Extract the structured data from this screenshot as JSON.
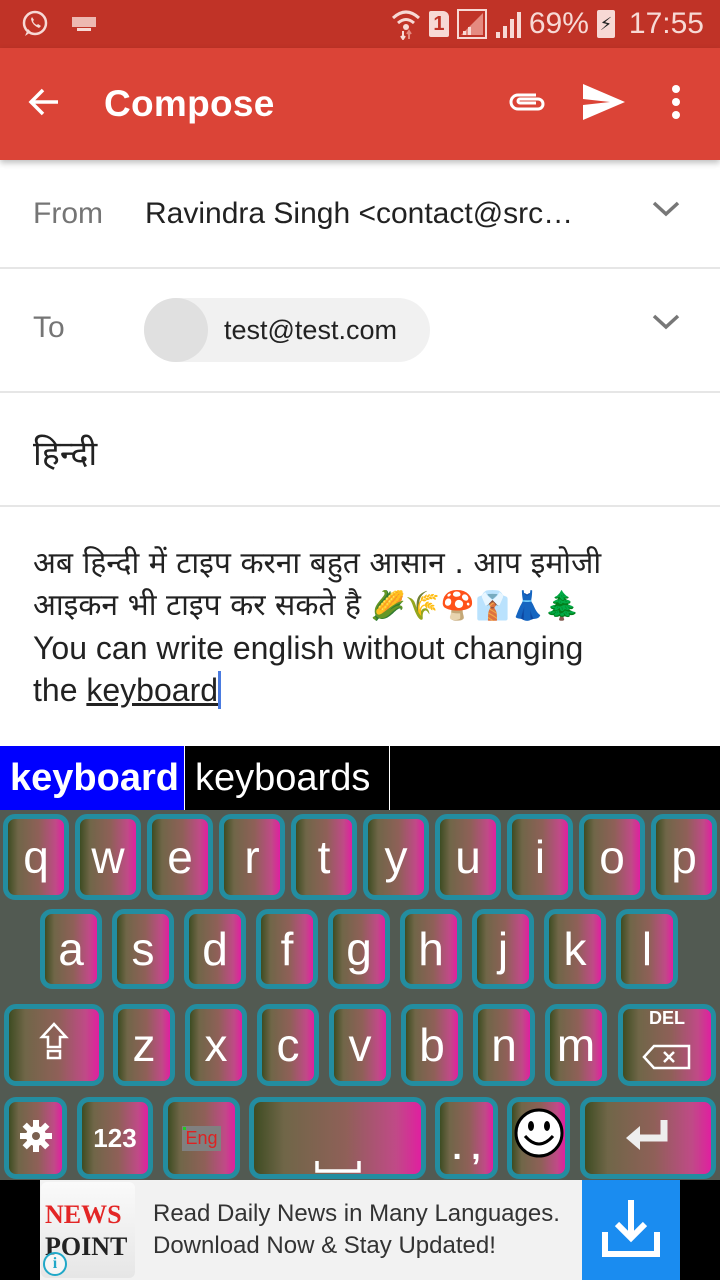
{
  "status_bar": {
    "left_icons": [
      "whatsapp-icon",
      "keyboard-icon"
    ],
    "right_icons": [
      "wifi-icon",
      "sim1-icon",
      "signal-sim1-icon",
      "signal-sim2-icon"
    ],
    "sim_label": "1",
    "battery": "69%",
    "time": "17:55"
  },
  "app_bar": {
    "title": "Compose",
    "actions": [
      "attach-icon",
      "send-icon",
      "more-options-icon"
    ],
    "color": "#db4437"
  },
  "form": {
    "from_label": "From",
    "from_value": "Ravindra Singh  <contact@src…",
    "to_label": "To",
    "to_chip": "test@test.com",
    "subject": "हिन्दी"
  },
  "body": {
    "line1": "अब हिन्दी में टाइप करना बहुत आसान . आप इमोजी",
    "line2": "आइकन भी टाइप कर सकते है ",
    "emojis": "🌽🌾🍄👔👗🌲",
    "line3": "You can write english without changing",
    "line4_prefix": "the ",
    "line4_word": "keyboard"
  },
  "suggestions": [
    "keyboard",
    "keyboards"
  ],
  "keyboard": {
    "row1": [
      "q",
      "w",
      "e",
      "r",
      "t",
      "y",
      "u",
      "i",
      "o",
      "p"
    ],
    "row2": [
      "a",
      "s",
      "d",
      "f",
      "g",
      "h",
      "j",
      "k",
      "l"
    ],
    "row3": [
      "z",
      "x",
      "c",
      "v",
      "b",
      "n",
      "m"
    ],
    "shift": "shift-icon",
    "del_label": "DEL",
    "numbers_label": "123",
    "lang_label": "Eng",
    "punct_label": ". ,",
    "settings": "settings-icon",
    "emoji": "smiley-icon",
    "enter": "enter-icon"
  },
  "ad": {
    "logo_line1": "NEWS",
    "logo_line2": "POINT",
    "line1": "Read Daily News in Many Languages.",
    "line2": "Download Now & Stay Updated!",
    "info": "i",
    "button_color": "#1a8cf0"
  }
}
